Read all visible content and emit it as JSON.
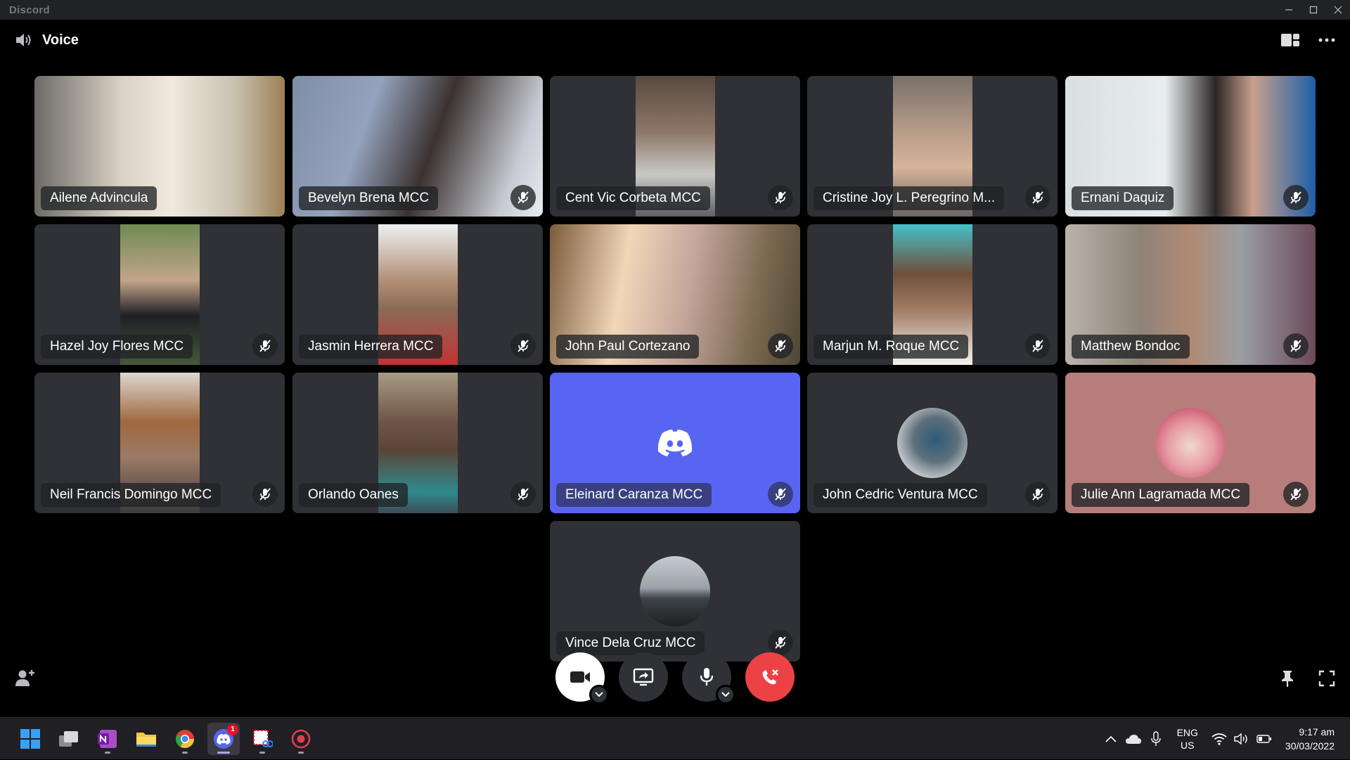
{
  "window": {
    "title": "Discord"
  },
  "header": {
    "title": "Voice"
  },
  "participants": [
    {
      "name": "Ailene Advincula",
      "muted": false
    },
    {
      "name": "Bevelyn Brena MCC",
      "muted": true
    },
    {
      "name": "Cent Vic Corbeta MCC",
      "muted": true
    },
    {
      "name": "Cristine Joy L. Peregrino M...",
      "muted": true
    },
    {
      "name": "Ernani Daquiz",
      "muted": true
    },
    {
      "name": "Hazel Joy Flores MCC",
      "muted": true
    },
    {
      "name": "Jasmin Herrera MCC",
      "muted": true
    },
    {
      "name": "John Paul Cortezano",
      "muted": true
    },
    {
      "name": "Marjun M. Roque MCC",
      "muted": true
    },
    {
      "name": "Matthew Bondoc",
      "muted": true
    },
    {
      "name": "Neil Francis Domingo MCC",
      "muted": true
    },
    {
      "name": "Orlando Oanes",
      "muted": true
    },
    {
      "name": "Eleinard Caranza MCC",
      "muted": true
    },
    {
      "name": "John Cedric Ventura MCC",
      "muted": true
    },
    {
      "name": "Julie Ann Lagramada MCC",
      "muted": true
    },
    {
      "name": "Vince Dela Cruz MCC",
      "muted": true
    }
  ],
  "colors": {
    "blurple": "#5865f2",
    "tile_bg": "#2f3136",
    "pink_tile": "#b77d7a",
    "danger": "#ed4245"
  },
  "taskbar": {
    "discord_badge": "1",
    "lang_top": "ENG",
    "lang_bottom": "US",
    "time": "9:17 am",
    "date": "30/03/2022"
  }
}
